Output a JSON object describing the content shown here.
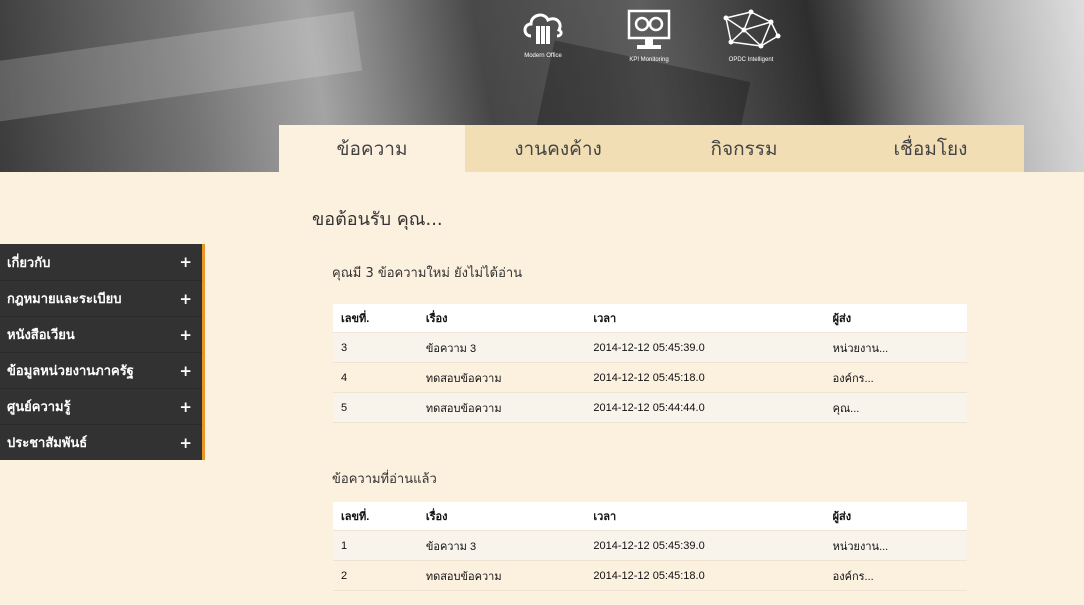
{
  "header": {
    "logos": [
      {
        "icon": "cloud-office-icon",
        "caption": "Modern Office"
      },
      {
        "icon": "kpi-monitor-icon",
        "caption": "KPI Monitoring"
      },
      {
        "icon": "network-icon",
        "caption": "OPDC Intelligent"
      }
    ]
  },
  "tabs": [
    {
      "label": "ข้อความ",
      "active": true
    },
    {
      "label": "งานคงค้าง",
      "active": false
    },
    {
      "label": "กิจกรรม",
      "active": false
    },
    {
      "label": "เชื่อมโยง",
      "active": false
    }
  ],
  "welcome": "ขอต้อนรับ คุณ...",
  "sidebar": {
    "items": [
      {
        "label": "เกี่ยวกับ",
        "expand": "+"
      },
      {
        "label": "กฎหมายและระเบียบ",
        "expand": "+"
      },
      {
        "label": "หนังสือเวียน",
        "expand": "+"
      },
      {
        "label": "ข้อมูลหน่วยงานภาครัฐ",
        "expand": "+"
      },
      {
        "label": "ศูนย์ความรู้",
        "expand": "+"
      },
      {
        "label": "ประชาสัมพันธ์",
        "expand": "+"
      }
    ]
  },
  "unread": {
    "title": "คุณมี 3 ข้อความใหม่ ยังไม่ได้อ่าน",
    "columns": [
      "เลขที่.",
      "เรื่อง",
      "เวลา",
      "ผู้ส่ง"
    ],
    "rows": [
      [
        "3",
        "ข้อความ 3",
        "2014-12-12 05:45:39.0",
        "หน่วยงาน..."
      ],
      [
        "4",
        "ทดสอบข้อความ",
        "2014-12-12 05:45:18.0",
        "องค์กร..."
      ],
      [
        "5",
        "ทดสอบข้อความ",
        "2014-12-12 05:44:44.0",
        "คุณ..."
      ]
    ]
  },
  "read": {
    "title": "ข้อความที่อ่านแล้ว",
    "columns": [
      "เลขที่.",
      "เรื่อง",
      "เวลา",
      "ผู้ส่ง"
    ],
    "rows": [
      [
        "1",
        "ข้อความ 3",
        "2014-12-12 05:45:39.0",
        "หน่วยงาน..."
      ],
      [
        "2",
        "ทดสอบข้อความ",
        "2014-12-12 05:45:18.0",
        "องค์กร..."
      ]
    ]
  },
  "colors": {
    "accent": "#e8962a",
    "tab_inactive": "#f1deb5",
    "background": "#fcf0df",
    "sidebar": "#323232"
  }
}
